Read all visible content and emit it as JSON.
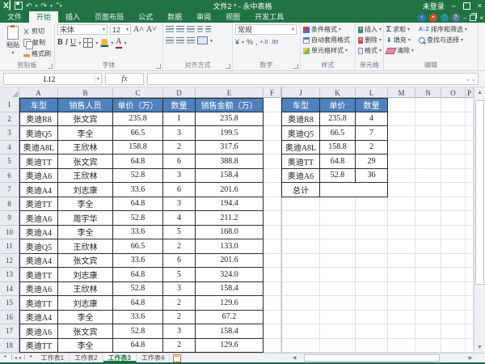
{
  "title_bar": {
    "title": "文件2 * - 永中表格",
    "login_status": "未登录"
  },
  "ribbon_tabs": {
    "items": [
      "文件",
      "开始",
      "插入",
      "页面布局",
      "公式",
      "数据",
      "审阅",
      "视图",
      "开发工具"
    ],
    "active": "开始"
  },
  "ribbon": {
    "clipboard": {
      "label": "剪贴板",
      "paste": "粘贴",
      "cut": "剪切",
      "copy": "复制",
      "format_painter": "格式刷"
    },
    "font": {
      "label": "字体",
      "name": "宋体",
      "size": "12",
      "bold": "B",
      "italic": "I",
      "underline": "U",
      "font_color": "A"
    },
    "alignment": {
      "label": "对齐方式"
    },
    "number": {
      "label": "数字",
      "format": "常规",
      "currency": "¥",
      "percent": "%",
      "comma": ",",
      "inc_decimal": "+.0",
      "dec_decimal": ".00"
    },
    "styles": {
      "label": "样式",
      "conditional": "条件格式",
      "autoformat": "自动套用格式",
      "cell_styles": "单元格样式"
    },
    "cells": {
      "label": "单元格",
      "insert": "插入",
      "delete": "删除",
      "format": "格式"
    },
    "editing": {
      "label": "编辑",
      "sum": "求和",
      "fill": "填充",
      "clear": "清除",
      "sort": "排序和筛选",
      "find": "查找与选择"
    }
  },
  "formula_bar": {
    "name_box": "L12",
    "fx": "fx",
    "formula": ""
  },
  "grid": {
    "columns": [
      "A",
      "B",
      "C",
      "D",
      "E",
      "F",
      "J",
      "K",
      "L",
      "M",
      "N",
      "O",
      "P"
    ],
    "row_count": 18,
    "active_cell": "L12"
  },
  "left_table": {
    "headers": [
      "车型",
      "销售人员",
      "单价（万）",
      "数量",
      "销售金额（万）"
    ],
    "rows": [
      [
        "奥迪R8",
        "张文宾",
        "235.8",
        "1",
        "235.8"
      ],
      [
        "奥迪Q5",
        "李全",
        "66.5",
        "3",
        "199.5"
      ],
      [
        "奥迪A8L",
        "王欣林",
        "158.8",
        "2",
        "317.6"
      ],
      [
        "奥迪TT",
        "张文宾",
        "64.8",
        "6",
        "388.8"
      ],
      [
        "奥迪A6",
        "王欣林",
        "52.8",
        "3",
        "158.4"
      ],
      [
        "奥迪A4",
        "刘志康",
        "33.6",
        "6",
        "201.6"
      ],
      [
        "奥迪TT",
        "李全",
        "64.8",
        "3",
        "194.4"
      ],
      [
        "奥迪A6",
        "周宇华",
        "52.8",
        "4",
        "211.2"
      ],
      [
        "奥迪A4",
        "李全",
        "33.6",
        "5",
        "168.0"
      ],
      [
        "奥迪Q5",
        "王欣林",
        "66.5",
        "2",
        "133.0"
      ],
      [
        "奥迪A4",
        "张文宾",
        "33.6",
        "6",
        "201.6"
      ],
      [
        "奥迪TT",
        "刘志康",
        "64.8",
        "5",
        "324.0"
      ],
      [
        "奥迪A6",
        "王欣林",
        "52.8",
        "3",
        "158.4"
      ],
      [
        "奥迪TT",
        "刘志康",
        "64.8",
        "2",
        "129.6"
      ],
      [
        "奥迪A4",
        "李全",
        "33.6",
        "2",
        "67.2"
      ],
      [
        "奥迪A6",
        "张文宾",
        "52.8",
        "3",
        "158.4"
      ],
      [
        "奥迪TT",
        "李全",
        "64.8",
        "2",
        "129.6"
      ]
    ]
  },
  "right_table": {
    "headers": [
      "车型",
      "单价",
      "数量"
    ],
    "rows": [
      [
        "奥迪R8",
        "235.8",
        "4"
      ],
      [
        "奥迪Q5",
        "66.5",
        "7"
      ],
      [
        "奥迪A8L",
        "158.8",
        "2"
      ],
      [
        "奥迪TT",
        "64.8",
        "29"
      ],
      [
        "奥迪A6",
        "52.8",
        "36"
      ]
    ],
    "total_label": "总计"
  },
  "sheet_tabs": {
    "items": [
      "工作表1",
      "工作表2",
      "工作表3",
      "工作表4"
    ],
    "active": "工作表3"
  },
  "colors": {
    "brand_green": "#217346",
    "table_header_blue": "#4f81bd",
    "status_strip_green": "#1d6a53"
  }
}
